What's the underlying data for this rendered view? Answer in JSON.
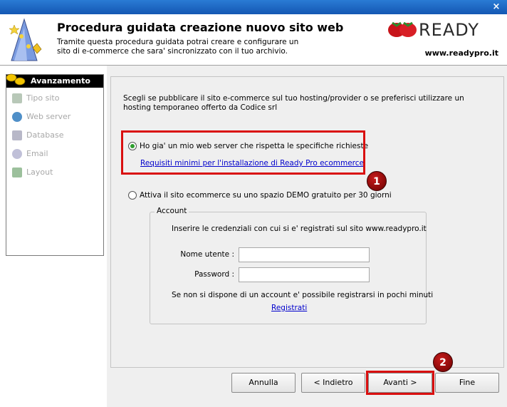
{
  "window": {
    "close_glyph": "×"
  },
  "header": {
    "title": "Procedura guidata creazione nuovo sito web",
    "description": "Tramite questa procedura guidata potrai creare e configurare un sito di e-commerce che sara' sincronizzato con il tuo archivio.",
    "logo_text": "READY",
    "site": "www.readypro.it"
  },
  "sidebar": {
    "heading": "Avanzamento",
    "steps": [
      {
        "label": "Tipo sito",
        "icon": "cart-icon"
      },
      {
        "label": "Web server",
        "icon": "globe-icon"
      },
      {
        "label": "Database",
        "icon": "database-icon"
      },
      {
        "label": "Email",
        "icon": "at-icon"
      },
      {
        "label": "Layout",
        "icon": "layout-icon"
      }
    ]
  },
  "main": {
    "intro": "Scegli se pubblicare il sito e-commerce sul tuo hosting/provider o se preferisci utilizzare un hosting temporaneo offerto da Codice srl",
    "option_own_server": "Ho gia' un mio web server che rispetta le specifiche richieste",
    "requirements_link": "Requisiti minimi per l'installazione di Ready Pro ecommerce",
    "option_demo": "Attiva il sito ecommerce su uno spazio DEMO gratuito per 30 giorni",
    "selected_option": "own_server",
    "account": {
      "legend": "Account",
      "info": "Inserire le credenziali con cui si e' registrati sul sito www.readypro.it",
      "username_label": "Nome utente :",
      "username_value": "",
      "password_label": "Password :",
      "password_value": "",
      "register_text": "Se non si dispone di un account e' possibile registrarsi in pochi minuti",
      "register_link": "Registrati"
    }
  },
  "buttons": {
    "cancel": "Annulla",
    "back": "< Indietro",
    "next": "Avanti >",
    "finish": "Fine"
  },
  "annotations": {
    "badge1": "1",
    "badge2": "2"
  },
  "colors": {
    "highlight": "#d90f0f",
    "link": "#0000cc",
    "radio_selected": "#2f9e2f"
  }
}
